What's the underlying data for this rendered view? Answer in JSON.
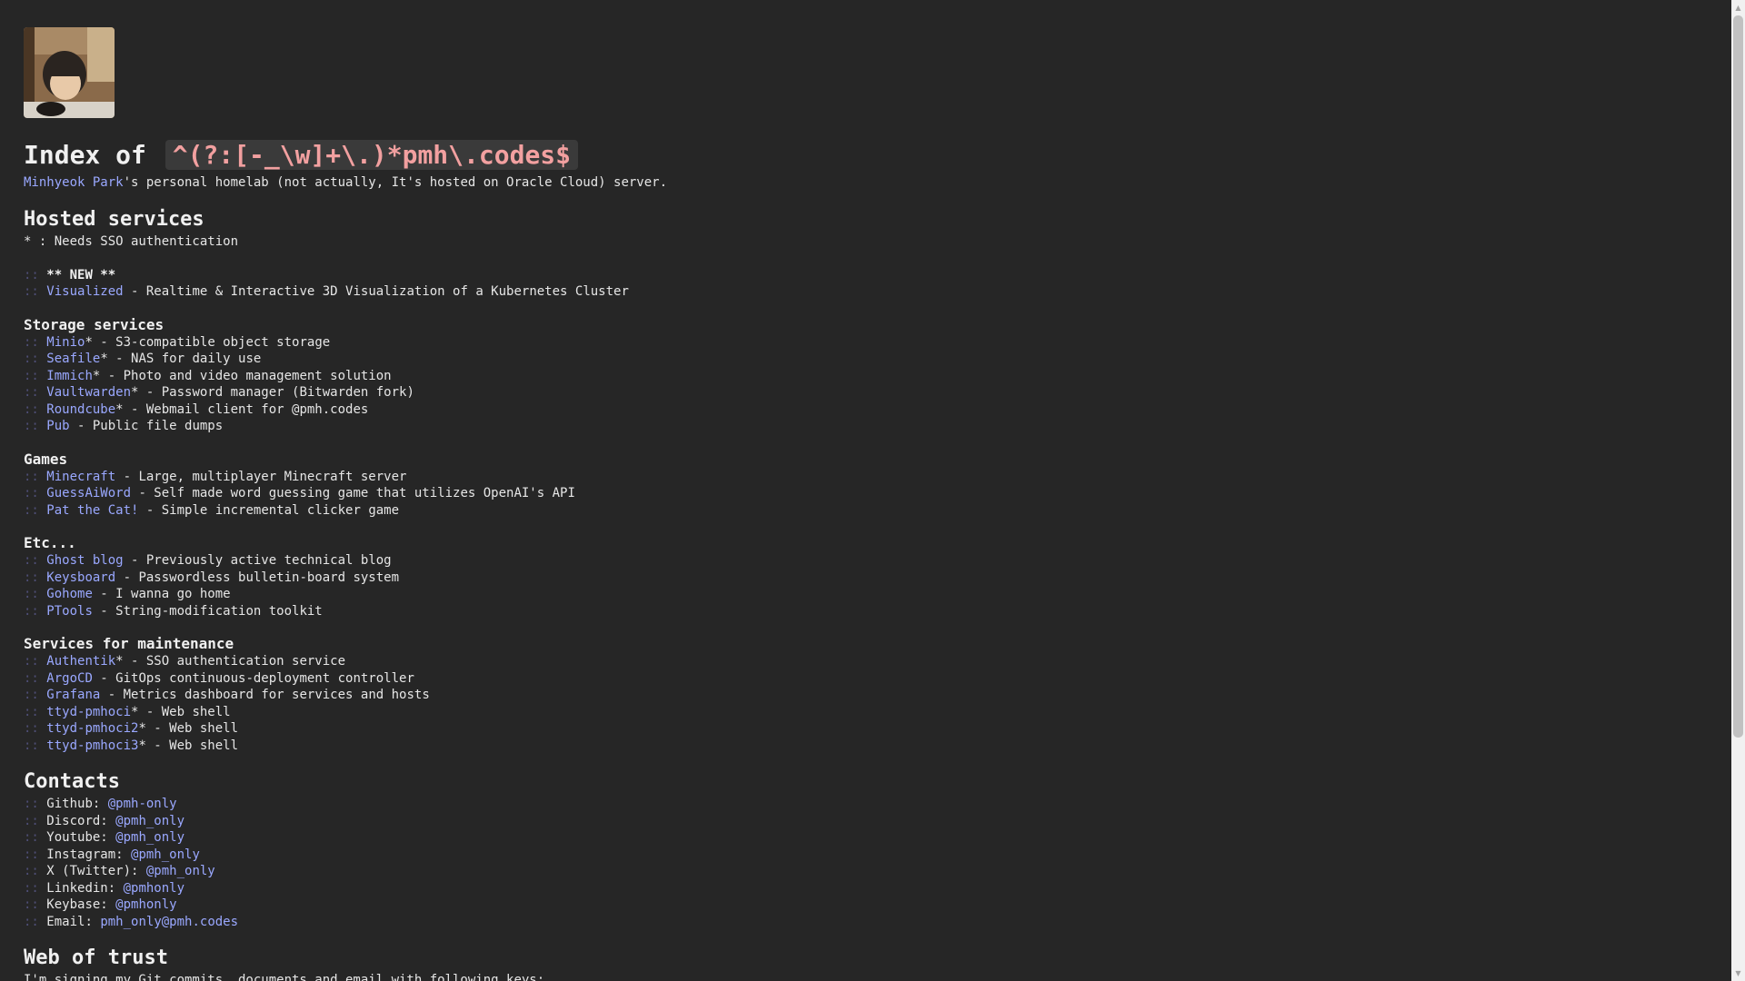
{
  "header": {
    "title_prefix": "Index of",
    "title_regex": "^(?:[-_\\w]+\\.)*pmh\\.codes$",
    "owner_link": "Minhyeok Park",
    "owner_suffix": "'s personal homelab (not actually, It's hosted on Oracle Cloud) server."
  },
  "separator": "::",
  "hosted": {
    "heading": "Hosted services",
    "note": "* : Needs SSO authentication",
    "new_label": "** NEW **",
    "new_item": {
      "name": "Visualized",
      "desc": " - Realtime & Interactive 3D Visualization of a Kubernetes Cluster"
    }
  },
  "storage": {
    "heading": "Storage services",
    "items": [
      {
        "name": "Minio",
        "desc": "* - S3-compatible object storage"
      },
      {
        "name": "Seafile",
        "desc": "* - NAS for daily use"
      },
      {
        "name": "Immich",
        "desc": "* - Photo and video management solution"
      },
      {
        "name": "Vaultwarden",
        "desc": "* - Password manager (Bitwarden fork)"
      },
      {
        "name": "Roundcube",
        "desc": "* - Webmail client for @pmh.codes"
      },
      {
        "name": "Pub",
        "desc": " - Public file dumps"
      }
    ]
  },
  "games": {
    "heading": "Games",
    "items": [
      {
        "name": "Minecraft",
        "desc": " - Large, multiplayer Minecraft server"
      },
      {
        "name": "GuessAiWord",
        "desc": " - Self made word guessing game that utilizes OpenAI's API"
      },
      {
        "name": "Pat the Cat!",
        "desc": " - Simple incremental clicker game"
      }
    ]
  },
  "etc": {
    "heading": "Etc...",
    "items": [
      {
        "name": "Ghost blog",
        "desc": " - Previously active technical blog"
      },
      {
        "name": "Keysboard",
        "desc": " - Passwordless bulletin-board system"
      },
      {
        "name": "Gohome",
        "desc": " - I wanna go home"
      },
      {
        "name": "PTools",
        "desc": " - String-modification toolkit"
      }
    ]
  },
  "maintenance": {
    "heading": "Services for maintenance",
    "items": [
      {
        "name": "Authentik",
        "desc": "* - SSO authentication service"
      },
      {
        "name": "ArgoCD",
        "desc": " - GitOps continuous-deployment controller"
      },
      {
        "name": "Grafana",
        "desc": " - Metrics dashboard for services and hosts"
      },
      {
        "name": "ttyd-pmhoci",
        "desc": "* - Web shell"
      },
      {
        "name": "ttyd-pmhoci2",
        "desc": "* - Web shell"
      },
      {
        "name": "ttyd-pmhoci3",
        "desc": "* - Web shell"
      }
    ]
  },
  "contacts": {
    "heading": "Contacts",
    "items": [
      {
        "label": "Github: ",
        "handle": "@pmh-only"
      },
      {
        "label": "Discord: ",
        "handle": "@pmh_only"
      },
      {
        "label": "Youtube: ",
        "handle": "@pmh_only"
      },
      {
        "label": "Instagram: ",
        "handle": "@pmh_only"
      },
      {
        "label": "X (Twitter): ",
        "handle": "@pmh_only"
      },
      {
        "label": "Linkedin: ",
        "handle": "@pmhonly"
      },
      {
        "label": "Keybase: ",
        "handle": "@pmhonly"
      },
      {
        "label": "Email: ",
        "handle": "pmh_only@pmh.codes"
      }
    ]
  },
  "trust": {
    "heading": "Web of trust",
    "text": "I'm signing my Git commits, documents and email with following keys:"
  },
  "colors": {
    "background": "#262626",
    "link": "#9aa8ff",
    "separator": "#4f4f77",
    "regex": "#f2a0a0"
  }
}
